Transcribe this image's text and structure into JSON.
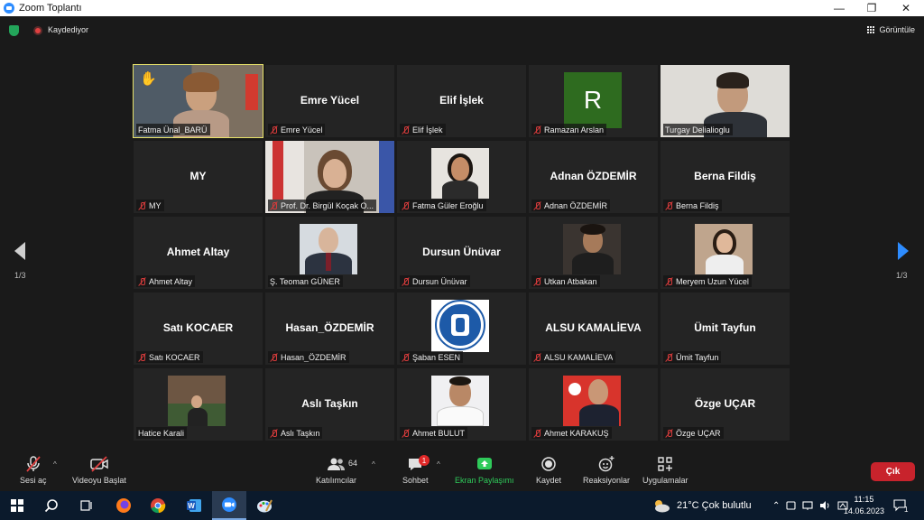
{
  "window": {
    "title": "Zoom Toplantı"
  },
  "status": {
    "recording": "Kaydediyor",
    "view_button": "Görüntüle"
  },
  "pagination": {
    "left": "1/3",
    "right": "1/3"
  },
  "tiles": [
    {
      "label": "Fatma Ünal_BARÜ",
      "big": "",
      "type": "video-raised",
      "muted": false
    },
    {
      "label": "Emre Yücel",
      "big": "Emre Yücel",
      "type": "name",
      "muted": true
    },
    {
      "label": "Elif İşlek",
      "big": "Elif İşlek",
      "type": "name",
      "muted": true
    },
    {
      "label": "Ramazan Arslan",
      "big": "R",
      "type": "avatar",
      "muted": true
    },
    {
      "label": "Turgay Delialioglu",
      "big": "",
      "type": "video-man",
      "muted": false
    },
    {
      "label": "MY",
      "big": "MY",
      "type": "name",
      "muted": true
    },
    {
      "label": "Prof. Dr. Birgül Koçak O...",
      "big": "",
      "type": "video-woman",
      "muted": true
    },
    {
      "label": "Fatma Güler Eroğlu",
      "big": "",
      "type": "photo-woman",
      "muted": true
    },
    {
      "label": "Adnan ÖZDEMİR",
      "big": "Adnan ÖZDEMİR",
      "type": "name",
      "muted": true
    },
    {
      "label": "Berna Fildiş",
      "big": "Berna Fildiş",
      "type": "name",
      "muted": true
    },
    {
      "label": "Ahmet Altay",
      "big": "Ahmet Altay",
      "type": "name",
      "muted": true
    },
    {
      "label": "Ş. Teoman GÜNER",
      "big": "",
      "type": "photo-suit",
      "muted": false
    },
    {
      "label": "Dursun Ünüvar",
      "big": "Dursun Ünüvar",
      "type": "name",
      "muted": true
    },
    {
      "label": "Utkan Atbakan",
      "big": "",
      "type": "photo-dark",
      "muted": true
    },
    {
      "label": "Meryem Uzun Yücel",
      "big": "",
      "type": "photo-girl",
      "muted": true
    },
    {
      "label": "Satı KOCAER",
      "big": "Satı KOCAER",
      "type": "name",
      "muted": true
    },
    {
      "label": "Hasan_ÖZDEMİR",
      "big": "Hasan_ÖZDEMİR",
      "type": "name",
      "muted": true
    },
    {
      "label": "Şaban ESEN",
      "big": "",
      "type": "logo",
      "muted": true
    },
    {
      "label": "ALSU KAMALİEVA",
      "big": "ALSU KAMALİEVA",
      "type": "name",
      "muted": true
    },
    {
      "label": "Ümit Tayfun",
      "big": "Ümit Tayfun",
      "type": "name",
      "muted": true
    },
    {
      "label": "Hatice Karali",
      "big": "",
      "type": "photo-outdoor",
      "muted": false
    },
    {
      "label": "Aslı Taşkın",
      "big": "Aslı Taşkın",
      "type": "name",
      "muted": true
    },
    {
      "label": "Ahmet BULUT",
      "big": "",
      "type": "photo-light",
      "muted": true
    },
    {
      "label": "Ahmet KARAKUŞ",
      "big": "",
      "type": "photo-flag",
      "muted": true
    },
    {
      "label": "Özge UÇAR",
      "big": "Özge UÇAR",
      "type": "name",
      "muted": true
    }
  ],
  "toolbar": {
    "unmute": "Sesi aç",
    "start_video": "Videoyu Başlat",
    "participants": "Katılımcılar",
    "participants_count": "64",
    "chat": "Sohbet",
    "chat_badge": "1",
    "share": "Ekran Paylaşımı",
    "record": "Kaydet",
    "reactions": "Reaksiyonlar",
    "apps": "Uygulamalar",
    "leave": "Çık"
  },
  "taskbar": {
    "weather": "21°C  Çok bulutlu",
    "time": "11:15",
    "date": "14.06.2023",
    "notifications": "1"
  },
  "colors": {
    "accent": "#2d8cff",
    "share_green": "#2fca5a",
    "leave_red": "#c8232c",
    "raised_border": "#e8e36a"
  }
}
